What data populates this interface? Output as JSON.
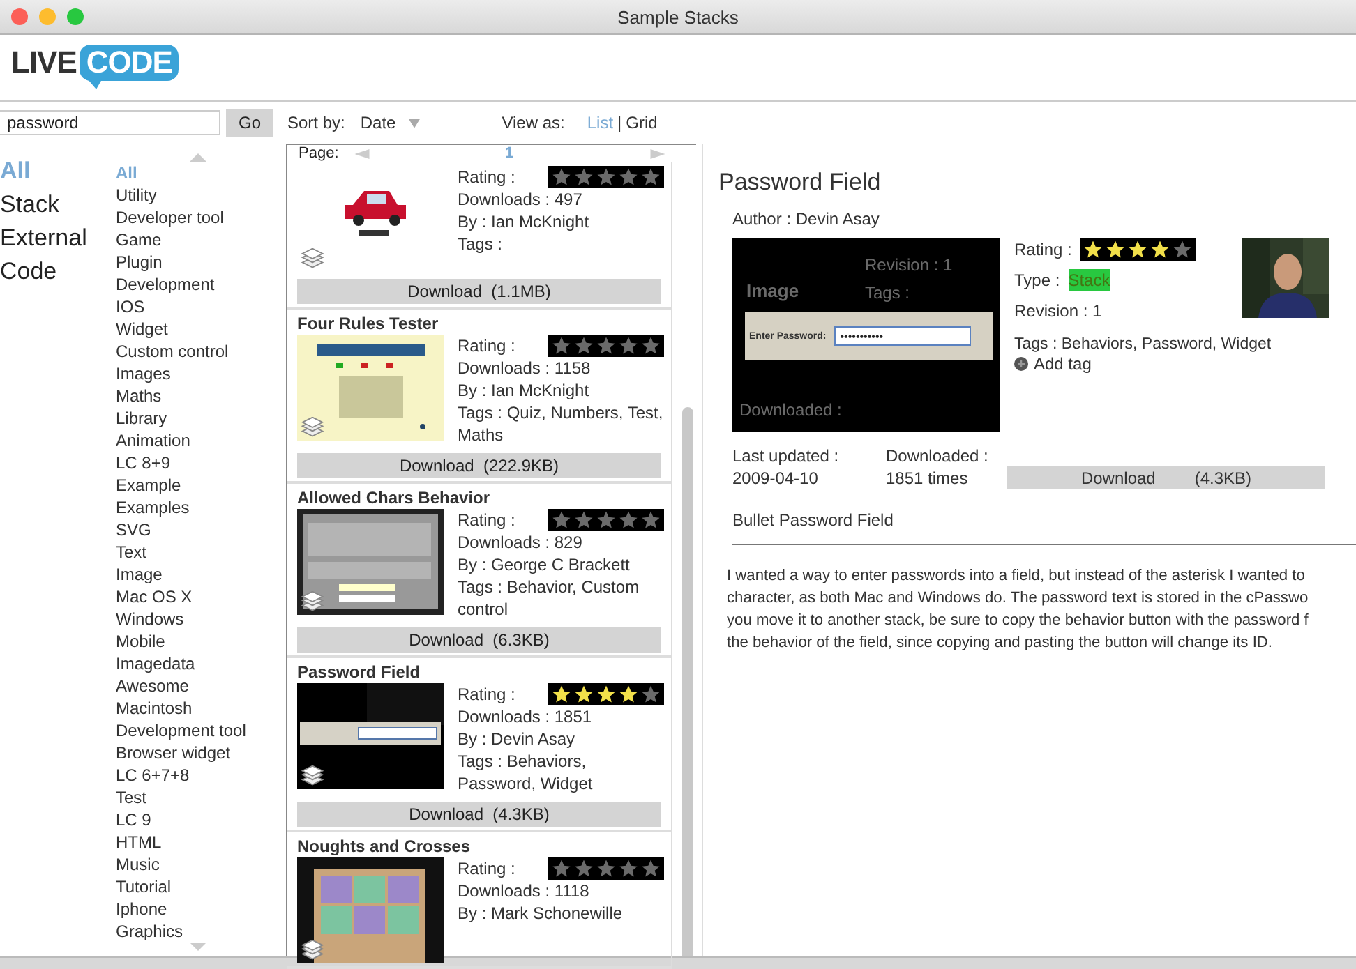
{
  "window": {
    "title": "Sample Stacks"
  },
  "logo": {
    "left": "LIVE",
    "right": "CODE"
  },
  "search": {
    "value": "password",
    "button": "Go"
  },
  "sort": {
    "label": "Sort by:",
    "value": "Date"
  },
  "view": {
    "label": "View as:",
    "separator": "|",
    "options": [
      {
        "label": "List",
        "selected": true
      },
      {
        "label": "Grid",
        "selected": false
      }
    ]
  },
  "types": [
    {
      "label": "All",
      "selected": true
    },
    {
      "label": "Stack",
      "selected": false
    },
    {
      "label": "External",
      "selected": false
    },
    {
      "label": "Code",
      "selected": false
    }
  ],
  "categories": [
    {
      "label": "All",
      "selected": true
    },
    {
      "label": "Utility",
      "selected": false
    },
    {
      "label": "Developer tool",
      "selected": false
    },
    {
      "label": "Game",
      "selected": false
    },
    {
      "label": "Plugin",
      "selected": false
    },
    {
      "label": "Development",
      "selected": false
    },
    {
      "label": "IOS",
      "selected": false
    },
    {
      "label": "Widget",
      "selected": false
    },
    {
      "label": "Custom control",
      "selected": false
    },
    {
      "label": "Images",
      "selected": false
    },
    {
      "label": "Maths",
      "selected": false
    },
    {
      "label": "Library",
      "selected": false
    },
    {
      "label": "Animation",
      "selected": false
    },
    {
      "label": "LC 8+9",
      "selected": false
    },
    {
      "label": "Example",
      "selected": false
    },
    {
      "label": "Examples",
      "selected": false
    },
    {
      "label": "SVG",
      "selected": false
    },
    {
      "label": "Text",
      "selected": false
    },
    {
      "label": "Image",
      "selected": false
    },
    {
      "label": "Mac OS X",
      "selected": false
    },
    {
      "label": "Windows",
      "selected": false
    },
    {
      "label": "Mobile",
      "selected": false
    },
    {
      "label": "Imagedata",
      "selected": false
    },
    {
      "label": "Awesome",
      "selected": false
    },
    {
      "label": "Macintosh",
      "selected": false
    },
    {
      "label": "Development tool",
      "selected": false
    },
    {
      "label": "Browser widget",
      "selected": false
    },
    {
      "label": "LC 6+7+8",
      "selected": false
    },
    {
      "label": "Test",
      "selected": false
    },
    {
      "label": "LC 9",
      "selected": false
    },
    {
      "label": "HTML",
      "selected": false
    },
    {
      "label": "Music",
      "selected": false
    },
    {
      "label": "Tutorial",
      "selected": false
    },
    {
      "label": "Iphone",
      "selected": false
    },
    {
      "label": "Graphics",
      "selected": false
    }
  ],
  "pager": {
    "label": "Page:",
    "page": "1"
  },
  "stacks": [
    {
      "thumbnail": {
        "kind": "car"
      },
      "rating": "Rating :",
      "stars": 0,
      "downloads": "Downloads :  497",
      "by": "By : Ian McKnight",
      "tags": "Tags :",
      "download": "Download  (1.1MB)"
    },
    {
      "title": "Four Rules Tester",
      "thumbnail": {
        "kind": "note"
      },
      "rating": "Rating :",
      "stars": 0,
      "downloads": "Downloads :  1158",
      "by": "By : Ian McKnight",
      "tags": "Tags :   Quiz, Numbers, Test, Maths",
      "download": "Download  (222.9KB)"
    },
    {
      "title": "Allowed Chars Behavior",
      "thumbnail": {
        "kind": "document"
      },
      "rating": "Rating :",
      "stars": 0,
      "downloads": "Downloads :  829",
      "by": "By : George C Brackett",
      "tags": "Tags :   Behavior, Custom control",
      "download": "Download  (6.3KB)"
    },
    {
      "title": "Password Field",
      "thumbnail": {
        "kind": "dark"
      },
      "rating": "Rating :",
      "stars": 4,
      "downloads": "Downloads :  1851",
      "by": "By : Devin Asay",
      "tags": "Tags :   Behaviors, Password, Widget",
      "download": "Download  (4.3KB)"
    },
    {
      "title": "Noughts and Crosses",
      "thumbnail": {
        "kind": "grid"
      },
      "rating": "Rating :",
      "stars": 0,
      "downloads": "Downloads :  1118",
      "by": "By : Mark Schonewille"
    }
  ],
  "detail": {
    "title": "Password Field",
    "author": "Author :   Devin Asay",
    "screenshot": {
      "faint": [
        "Revision :  1",
        "Image",
        "Tags :",
        "Downloaded :"
      ],
      "label": "Enter Password:",
      "value": "•••••••••••"
    },
    "rating": "Rating :",
    "stars": 4,
    "type_label": "Type :",
    "type": "Stack",
    "revision": "Revision :  1",
    "tags": "Tags :   Behaviors, Password, Widget",
    "add_tag": "Add tag",
    "updated_label": "Last updated :",
    "updated": "2009-04-10",
    "downloaded_label": "Downloaded :",
    "downloaded": "1851 times",
    "download": "Download",
    "size": "(4.3KB)",
    "subtitle": "Bullet Password Field",
    "description": [
      "I wanted a way to enter passwords into a field, but instead of the asterisk I wanted to",
      "character, as both Mac and Windows do. The password text is stored in the cPasswo",
      "you move it to another stack, be sure to copy the behavior button with the password f",
      "the behavior of the field, since copying and pasting the button will change its ID."
    ]
  }
}
